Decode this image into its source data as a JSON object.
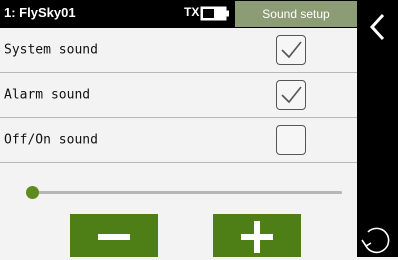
{
  "topbar": {
    "model_name": "1: FlySky01",
    "tx_label": "TX",
    "screen_title": "Sound setup",
    "battery_icon": "battery-icon"
  },
  "settings": {
    "items": [
      {
        "label": "System sound",
        "checked": true
      },
      {
        "label": "Alarm sound",
        "checked": true
      },
      {
        "label": "Off/On sound",
        "checked": false
      }
    ]
  },
  "volume_slider": {
    "value_fraction": 0.0
  },
  "buttons": {
    "decrease_icon": "minus-icon",
    "increase_icon": "plus-icon"
  },
  "nav": {
    "back_icon": "chevron-left-icon",
    "reset_icon": "rotate-icon"
  },
  "colors": {
    "accent_green": "#4e7e16",
    "slider_thumb": "#5c8c1c",
    "title_bg": "#8c9c74",
    "bar_bg": "#000000"
  }
}
